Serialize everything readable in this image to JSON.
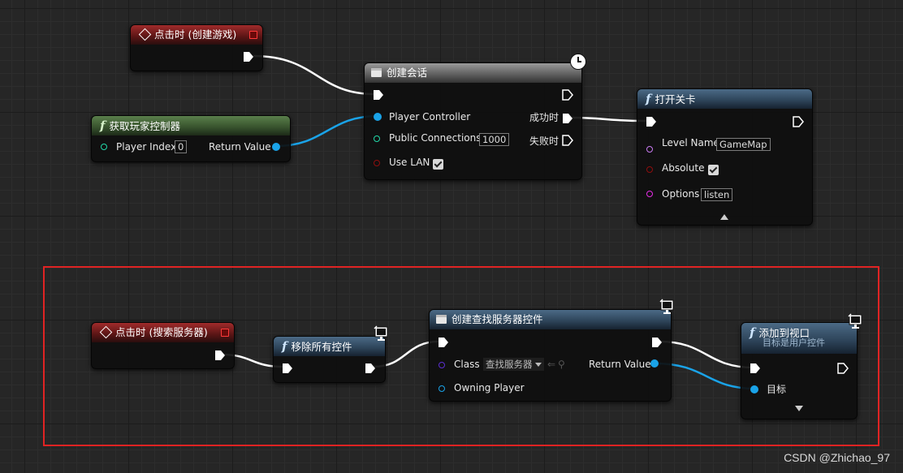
{
  "nodes": {
    "event_create": {
      "title": "点击时 (创建游戏)"
    },
    "get_pc": {
      "title": "获取玩家控制器",
      "player_index_label": "Player Index",
      "player_index_value": "0",
      "return_label": "Return Value"
    },
    "create_session": {
      "title": "创建会话",
      "player_controller": "Player Controller",
      "public_connections": "Public Connections",
      "public_connections_value": "1000",
      "use_lan": "Use LAN",
      "use_lan_checked": true,
      "on_success": "成功时",
      "on_failure": "失败时"
    },
    "open_level": {
      "title": "打开关卡",
      "level_name": "Level Name",
      "level_name_value": "GameMap",
      "absolute": "Absolute",
      "absolute_checked": true,
      "options": "Options",
      "options_value": "listen"
    },
    "event_search": {
      "title": "点击时 (搜索服务器)"
    },
    "remove_all": {
      "title": "移除所有控件"
    },
    "create_widget": {
      "title": "创建查找服务器控件",
      "class_label": "Class",
      "class_value": "查找服务器",
      "return_label": "Return Value",
      "owning_player": "Owning Player"
    },
    "add_viewport": {
      "title": "添加到视口",
      "subtitle": "目标是用户控件",
      "target_label": "目标"
    }
  },
  "watermark": "CSDN @Zhichao_97",
  "colors": {
    "exec": "#ffffff",
    "object_pin": "#1aa3e8",
    "int_pin": "#22d8a8",
    "bool_pin": "#8e0e0e",
    "name_pin": "#c97bf2",
    "string_pin": "#e62de6",
    "class_pin": "#5b2fd0",
    "highlight": "#e02323"
  },
  "icons": [
    "event-diamond-icon",
    "function-icon",
    "macro-book-icon",
    "clock-icon",
    "client-only-icon",
    "checkbox-icon",
    "dropdown-arrow-icon"
  ]
}
